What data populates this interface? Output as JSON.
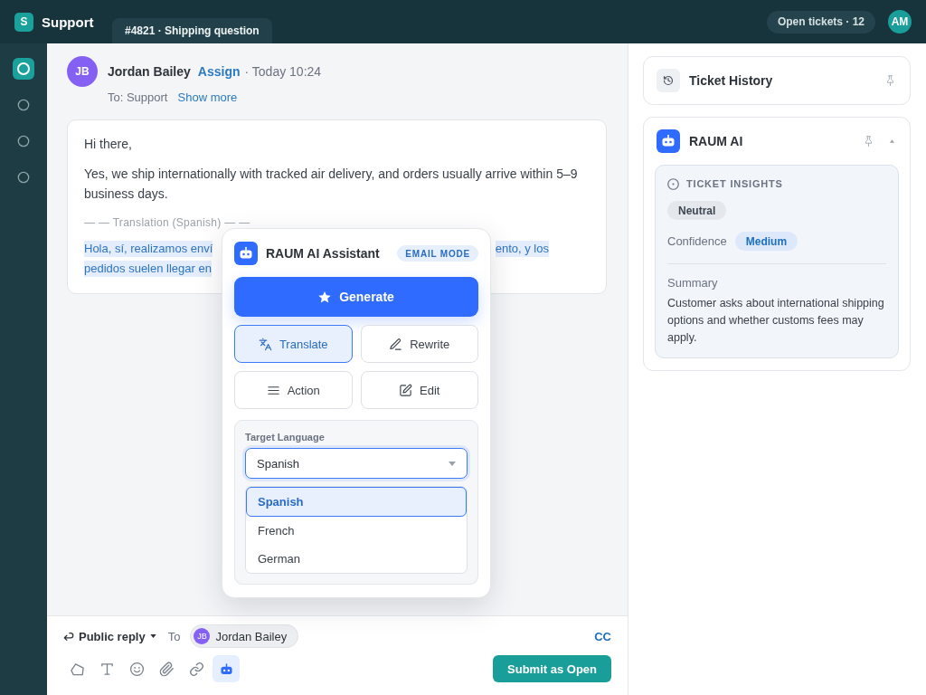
{
  "app": {
    "logo_letter": "S",
    "name": "Support"
  },
  "ticket_tab": {
    "label": "#4821 · Shipping question"
  },
  "header_right": {
    "open_tickets": "Open tickets · 12",
    "user_initials": "AM"
  },
  "sidebar": {
    "items": [
      {
        "selected": true
      },
      {
        "selected": false
      },
      {
        "selected": false
      },
      {
        "selected": false
      }
    ]
  },
  "message": {
    "sender_initials": "JB",
    "sender": "Jordan Bailey",
    "assign": "Assign",
    "meta": "· Today 10:24",
    "to": "To: Support",
    "show_more": "Show more",
    "paragraphs": [
      "Hi there,",
      "Yes, we ship internationally with tracked air delivery, and orders usually arrive within 5–9 business days."
    ],
    "translation_label": "— — Translation (Spanish) — —",
    "translation_lines": [
      [
        "Hola, sí, realizamos enví",
        "ento, y los"
      ],
      [
        "pedidos suelen llegar en"
      ]
    ]
  },
  "assistant_popup": {
    "title": "RAUM AI Assistant",
    "mode": "EMAIL MODE",
    "generate": "Generate",
    "actions": [
      {
        "kind": "translate",
        "label": "Translate",
        "selected": true
      },
      {
        "kind": "rewrite",
        "label": "Rewrite",
        "selected": false
      },
      {
        "kind": "list",
        "label": "Action",
        "selected": false
      },
      {
        "kind": "edit",
        "label": "Edit",
        "selected": false
      }
    ],
    "target_language": {
      "label": "Target Language",
      "value": "Spanish",
      "expanded": true,
      "options": [
        {
          "label": "Spanish",
          "selected": true
        },
        {
          "label": "French",
          "selected": false
        },
        {
          "label": "German",
          "selected": false
        }
      ]
    }
  },
  "right_panel": {
    "ticket_history": {
      "title": "Ticket History"
    },
    "raum_ai": {
      "title": "RAUM AI",
      "expanded": true,
      "insights": {
        "heading": "TICKET INSIGHTS",
        "sentiment": "Neutral",
        "confidence_label": "Confidence",
        "confidence": "Medium",
        "summary_label": "Summary",
        "summary": "Customer asks about international shipping options and whether customs fees may apply."
      }
    }
  },
  "composer": {
    "reply_mode": "Public reply",
    "to_label": "To",
    "recipient": {
      "initials": "JB",
      "name": "Jordan Bailey"
    },
    "cc": "CC",
    "tools": [
      {
        "kind": "shape",
        "selected": false
      },
      {
        "kind": "text",
        "selected": false
      },
      {
        "kind": "emoji",
        "selected": false
      },
      {
        "kind": "attach",
        "selected": false
      },
      {
        "kind": "link",
        "selected": false
      },
      {
        "kind": "assistant",
        "selected": true
      }
    ],
    "submit": "Submit as Open"
  }
}
